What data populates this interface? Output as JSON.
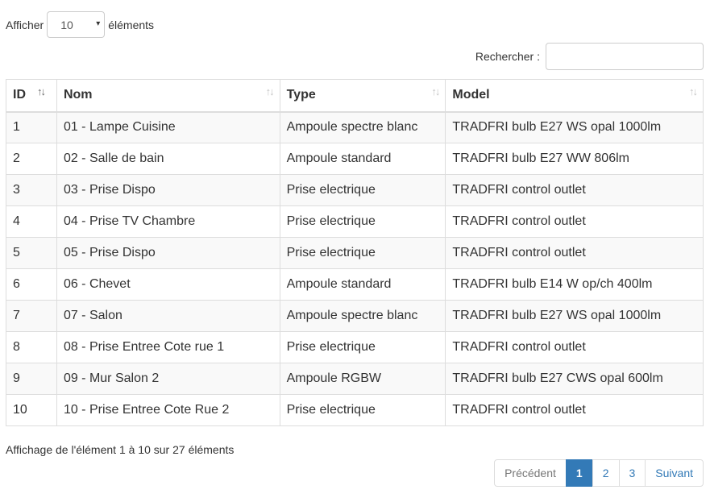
{
  "length": {
    "prefix": "Afficher",
    "value": "10",
    "suffix": "éléments",
    "caret_icon": "▾"
  },
  "search": {
    "label": "Rechercher :",
    "value": ""
  },
  "table": {
    "headers": [
      "ID",
      "Nom",
      "Type",
      "Model"
    ],
    "sort_icon": "↑↓",
    "rows": [
      [
        "1",
        "01 - Lampe Cuisine",
        "Ampoule spectre blanc",
        "TRADFRI bulb E27 WS opal 1000lm"
      ],
      [
        "2",
        "02 - Salle de bain",
        "Ampoule standard",
        "TRADFRI bulb E27 WW 806lm"
      ],
      [
        "3",
        "03 - Prise Dispo",
        "Prise electrique",
        "TRADFRI control outlet"
      ],
      [
        "4",
        "04 - Prise TV Chambre",
        "Prise electrique",
        "TRADFRI control outlet"
      ],
      [
        "5",
        "05 - Prise Dispo",
        "Prise electrique",
        "TRADFRI control outlet"
      ],
      [
        "6",
        "06 - Chevet",
        "Ampoule standard",
        "TRADFRI bulb E14 W op/ch 400lm"
      ],
      [
        "7",
        "07 - Salon",
        "Ampoule spectre blanc",
        "TRADFRI bulb E27 WS opal 1000lm"
      ],
      [
        "8",
        "08 - Prise Entree Cote rue 1",
        "Prise electrique",
        "TRADFRI control outlet"
      ],
      [
        "9",
        "09 - Mur Salon 2",
        "Ampoule RGBW",
        "TRADFRI bulb E27 CWS opal 600lm"
      ],
      [
        "10",
        "10 - Prise Entree Cote Rue 2",
        "Prise electrique",
        "TRADFRI control outlet"
      ]
    ]
  },
  "info": "Affichage de l'élément 1 à 10 sur 27 éléments",
  "pagination": {
    "previous": "Précédent",
    "pages": [
      "1",
      "2",
      "3"
    ],
    "current": "1",
    "next": "Suivant"
  },
  "colors": {
    "accent": "#337ab7",
    "border": "#dddddd",
    "stripe": "#f9f9f9"
  }
}
